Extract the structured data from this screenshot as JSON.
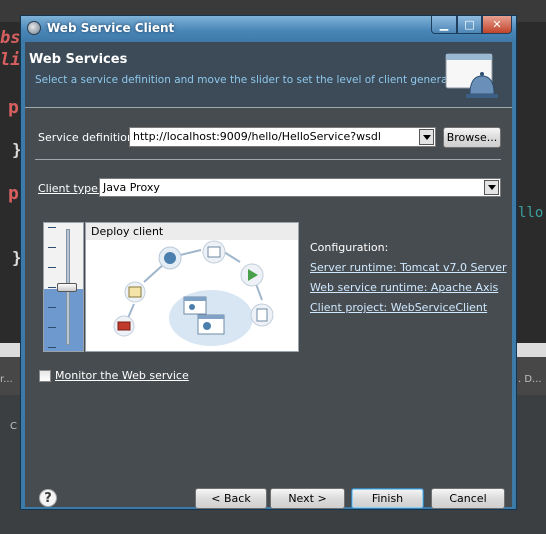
{
  "window": {
    "title": "Web Service Client"
  },
  "window_controls": {
    "minimize": "▁",
    "maximize": "□",
    "close": "✕"
  },
  "header": {
    "title": "Web Services",
    "description": "Select a service definition and move the slider to set the level of client generation."
  },
  "service_definition": {
    "label": "Service definition:",
    "value": "http://localhost:9009/hello/HelloService?wsdl",
    "browse_label": "Browse..."
  },
  "client_type": {
    "label": "Client type:",
    "value": "Java Proxy"
  },
  "slider": {
    "level_label": "Deploy client",
    "level_fraction": 0.5
  },
  "configuration": {
    "label": "Configuration:",
    "server_runtime": "Server runtime: Tomcat v7.0 Server",
    "webservice_runtime": "Web service runtime: Apache Axis",
    "client_project": "Client project: WebServiceClient"
  },
  "monitor": {
    "label": "Monitor the Web service",
    "checked": false
  },
  "buttons": {
    "back": "< Back",
    "next": "Next >",
    "finish": "Finish",
    "cancel": "Cancel"
  },
  "help_icon": "?",
  "background_ide": {
    "line1": "bs",
    "line2": "li",
    "line3": "p",
    "line4": "}",
    "line5": "p",
    "line6": "}",
    "right_fragment": "llo",
    "tab_left": "r...",
    "tab_right": ". D...",
    "console_fragment": "C"
  },
  "colors": {
    "title_bar": "#4a87b8",
    "dialog_body": "#474c50",
    "header_desc_text": "#8ec8ee",
    "link_text": "#cfe8ff",
    "slider_fill": "#6d99cf"
  }
}
